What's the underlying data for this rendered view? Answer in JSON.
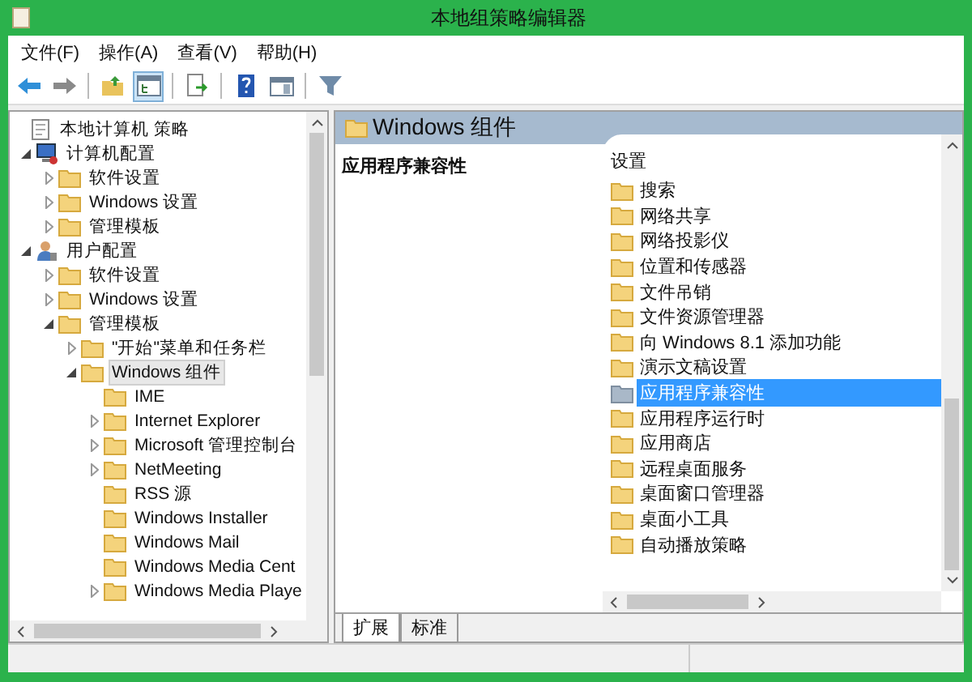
{
  "window": {
    "title": "本地组策略编辑器"
  },
  "menu": [
    "文件(F)",
    "操作(A)",
    "查看(V)",
    "帮助(H)"
  ],
  "toolbar": [
    [
      {
        "kind": "back",
        "pressed": false
      },
      {
        "kind": "forward",
        "pressed": false
      }
    ],
    [
      {
        "kind": "up",
        "pressed": false
      },
      {
        "kind": "tree",
        "pressed": true
      }
    ],
    [
      {
        "kind": "export",
        "pressed": false
      }
    ],
    [
      {
        "kind": "help",
        "pressed": false
      },
      {
        "kind": "panel",
        "pressed": false
      }
    ],
    [
      {
        "kind": "filter",
        "pressed": false
      }
    ]
  ],
  "tree": [
    {
      "label": "本地计算机 策略",
      "kind": "policy",
      "selected": false,
      "children": [
        {
          "label": "计算机配置",
          "kind": "computer",
          "expanded": true,
          "selected": false,
          "children": [
            {
              "label": "软件设置",
              "kind": "folder",
              "expanded": false,
              "selected": false
            },
            {
              "label": "Windows 设置",
              "kind": "folder",
              "expanded": false,
              "selected": false
            },
            {
              "label": "管理模板",
              "kind": "folder",
              "expanded": false,
              "selected": false
            }
          ]
        },
        {
          "label": "用户配置",
          "kind": "user",
          "expanded": true,
          "selected": false,
          "children": [
            {
              "label": "软件设置",
              "kind": "folder",
              "expanded": false,
              "selected": false
            },
            {
              "label": "Windows 设置",
              "kind": "folder",
              "expanded": false,
              "selected": false
            },
            {
              "label": "管理模板",
              "kind": "folder",
              "expanded": true,
              "selected": false,
              "children": [
                {
                  "label": "\"开始\"菜单和任务栏",
                  "kind": "folder",
                  "expanded": false,
                  "selected": false
                },
                {
                  "label": "Windows 组件",
                  "kind": "folder",
                  "expanded": true,
                  "selected": true,
                  "children": [
                    {
                      "label": "IME",
                      "kind": "folder",
                      "selected": false
                    },
                    {
                      "label": "Internet Explorer",
                      "kind": "folder",
                      "expanded": false,
                      "selected": false
                    },
                    {
                      "label": "Microsoft 管理控制台",
                      "kind": "folder",
                      "expanded": false,
                      "selected": false
                    },
                    {
                      "label": "NetMeeting",
                      "kind": "folder",
                      "expanded": false,
                      "selected": false
                    },
                    {
                      "label": "RSS 源",
                      "kind": "folder",
                      "selected": false
                    },
                    {
                      "label": "Windows Installer",
                      "kind": "folder",
                      "selected": false
                    },
                    {
                      "label": "Windows Mail",
                      "kind": "folder",
                      "selected": false
                    },
                    {
                      "label": "Windows Media Cent",
                      "kind": "folder",
                      "selected": false
                    },
                    {
                      "label": "Windows Media Playe",
                      "kind": "folder",
                      "expanded": false,
                      "selected": false
                    }
                  ]
                }
              ]
            }
          ]
        }
      ]
    }
  ],
  "content": {
    "heading": "Windows 组件",
    "description": "应用程序兼容性",
    "column": "设置",
    "items": [
      {
        "label": "搜索",
        "selected": false
      },
      {
        "label": "网络共享",
        "selected": false
      },
      {
        "label": "网络投影仪",
        "selected": false
      },
      {
        "label": "位置和传感器",
        "selected": false
      },
      {
        "label": "文件吊销",
        "selected": false
      },
      {
        "label": "文件资源管理器",
        "selected": false
      },
      {
        "label": "向 Windows 8.1 添加功能",
        "selected": false
      },
      {
        "label": "演示文稿设置",
        "selected": false
      },
      {
        "label": "应用程序兼容性",
        "selected": true
      },
      {
        "label": "应用程序运行时",
        "selected": false
      },
      {
        "label": "应用商店",
        "selected": false
      },
      {
        "label": "远程桌面服务",
        "selected": false
      },
      {
        "label": "桌面窗口管理器",
        "selected": false
      },
      {
        "label": "桌面小工具",
        "selected": false
      },
      {
        "label": "自动播放策略",
        "selected": false
      }
    ]
  },
  "tabs": [
    {
      "label": "扩展",
      "selected": true
    },
    {
      "label": "标准",
      "selected": false
    }
  ]
}
